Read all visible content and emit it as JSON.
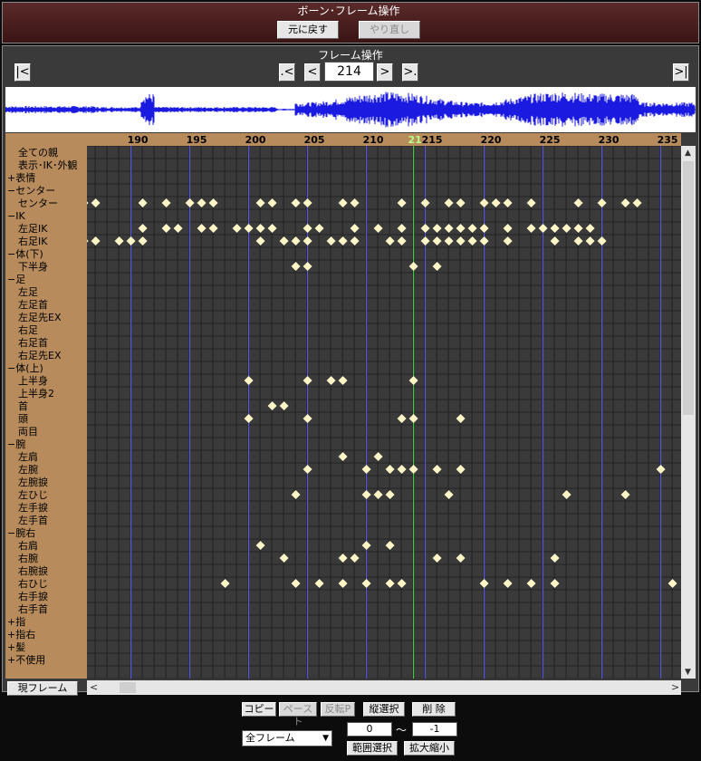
{
  "bone_panel": {
    "title": "ボーン･フレーム操作",
    "undo_label": "元に戻す",
    "redo_label": "やり直し"
  },
  "frame_panel": {
    "title": "フレーム操作",
    "first_label": "|<",
    "prev_key_label": ".<",
    "prev_label": "<",
    "current_frame": "214",
    "next_label": ">",
    "next_key_label": ">.",
    "last_label": ">|"
  },
  "timeline": {
    "tick_labels": [
      "190",
      "195",
      "200",
      "205",
      "210",
      "215",
      "220",
      "225",
      "230",
      "235"
    ],
    "current_marker": "21",
    "rows": [
      "全ての親",
      "表示･IK･外観",
      "+表情",
      "−センター",
      "センター",
      "−IK",
      "左足IK",
      "右足IK",
      "−体(下)",
      "下半身",
      "−足",
      "左足",
      "左足首",
      "左足先EX",
      "右足",
      "右足首",
      "右足先EX",
      "−体(上)",
      "上半身",
      "上半身2",
      "首",
      "頭",
      "両目",
      "−腕",
      "左肩",
      "左腕",
      "左腕捩",
      "左ひじ",
      "左手捩",
      "左手首",
      "−腕右",
      "右肩",
      "右腕",
      "右腕捩",
      "右ひじ",
      "右手捩",
      "右手首",
      "+指",
      "+指右",
      "+髪",
      "+不使用"
    ],
    "row_indent": [
      1,
      1,
      0,
      0,
      1,
      0,
      1,
      1,
      0,
      1,
      0,
      1,
      1,
      1,
      1,
      1,
      1,
      0,
      1,
      1,
      1,
      1,
      1,
      0,
      1,
      1,
      1,
      1,
      1,
      1,
      0,
      1,
      1,
      1,
      1,
      1,
      1,
      0,
      0,
      0,
      0
    ],
    "keyframes": {
      "4": [
        186,
        187,
        191,
        193,
        195,
        196,
        197,
        201,
        202,
        204,
        205,
        208,
        209,
        213,
        215,
        217,
        218,
        220,
        221,
        222,
        224,
        228,
        230,
        232,
        233
      ],
      "6": [
        191,
        193,
        194,
        196,
        197,
        199,
        200,
        201,
        202,
        205,
        206,
        209,
        211,
        213,
        215,
        216,
        217,
        218,
        219,
        220,
        222,
        224,
        225,
        226,
        227,
        228,
        229
      ],
      "7": [
        186,
        187,
        189,
        190,
        191,
        201,
        203,
        204,
        205,
        207,
        208,
        209,
        212,
        213,
        215,
        216,
        217,
        218,
        219,
        220,
        222,
        226,
        228,
        229,
        230
      ],
      "9": [
        204,
        205,
        214,
        216
      ],
      "18": [
        200,
        205,
        207,
        208,
        214
      ],
      "20": [
        202,
        203
      ],
      "21": [
        200,
        205,
        213,
        214,
        218
      ],
      "24": [
        208,
        211
      ],
      "25": [
        205,
        210,
        212,
        213,
        214,
        216,
        218,
        235
      ],
      "27": [
        204,
        210,
        211,
        212,
        217,
        227,
        232
      ],
      "31": [
        201,
        210,
        212
      ],
      "32": [
        203,
        208,
        209,
        216,
        218,
        226
      ],
      "34": [
        198,
        204,
        206,
        208,
        210,
        212,
        213,
        220,
        222,
        224,
        226,
        236
      ]
    }
  },
  "bottom": {
    "reset_frame_label": "現フレーム",
    "copy_label": "コピー",
    "paste_label": "ペースト",
    "flip_paste_label": "反転P",
    "vertical_select_label": "縦選択",
    "delete_label": "削 除",
    "range_select_label": "範囲選択",
    "zoom_label": "拡大縮小",
    "frame_select_value": "全フレーム",
    "range_from": "0",
    "range_sep": "〜",
    "range_to": "-1"
  },
  "colors": {
    "grid_bg": "#222222",
    "grid_cell": "#3a3a3a",
    "frame_line": "#5a5aff",
    "current_line": "#44dd44",
    "key": "#fff6c8",
    "label_bg": "#b78b5c"
  }
}
